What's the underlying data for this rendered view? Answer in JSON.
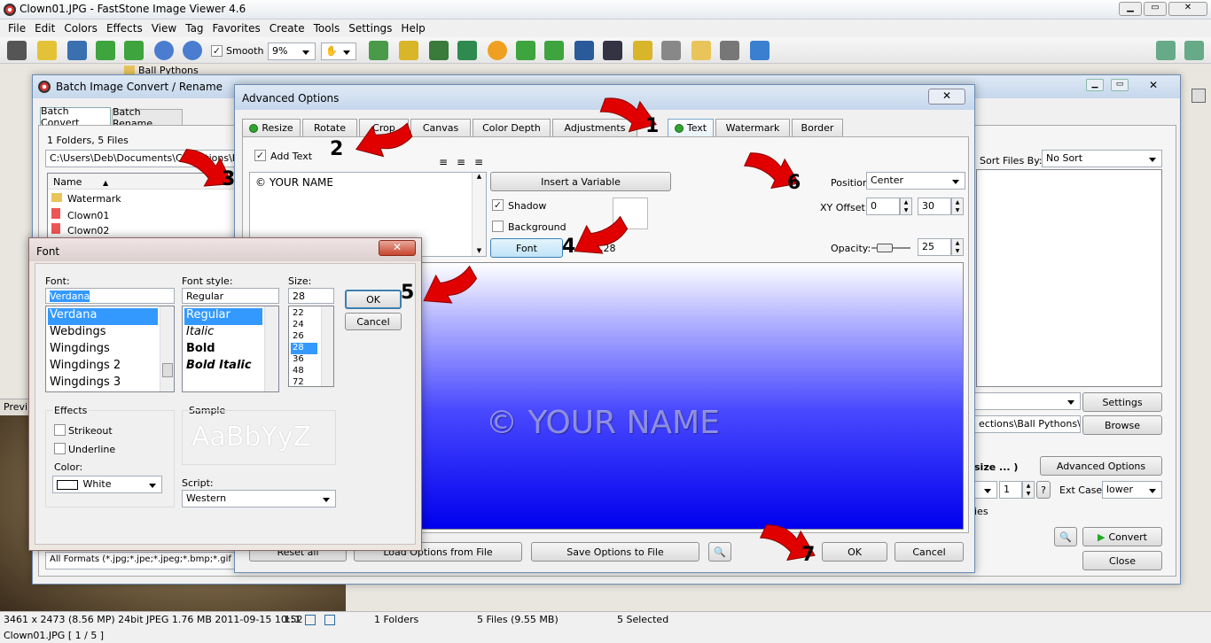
{
  "app": {
    "title": "Clown01.JPG  -  FastStone Image Viewer 4.6",
    "menu": [
      "File",
      "Edit",
      "Colors",
      "Effects",
      "View",
      "Tag",
      "Favorites",
      "Create",
      "Tools",
      "Settings",
      "Help"
    ],
    "smooth_label": "Smooth",
    "zoom": "9%",
    "tree_item": "Ball Pythons",
    "status": {
      "left": "3461 x 2473 (8.56 MP)  24bit  JPEG   1.76 MB   2011-09-15 10:52",
      "ratio": "1:1",
      "folders": "1 Folders",
      "files": "5 Files (9.55 MB)",
      "selected": "5 Selected",
      "bottom": "Clown01.JPG [ 1 / 5 ]"
    },
    "preview_label": "Previ"
  },
  "batch": {
    "title": "Batch Image Convert / Rename",
    "tabs": [
      "Batch Convert",
      "Batch Rename"
    ],
    "folder_info": "1 Folders, 5 Files",
    "path": "C:\\Users\\Deb\\Documents\\Collections\\Ball Pyt",
    "name_header": "Name",
    "files": [
      "Watermark",
      "Clown01",
      "Clown02"
    ],
    "sort_label": "Sort Files By:",
    "sort_value": "No Sort",
    "settings_btn": "Settings",
    "browse_btn": "Browse",
    "output_path": "ections\\Ball Pythons\\Clov",
    "resize_text": "size ... )",
    "advanced_btn": "Advanced Options",
    "spin_value": "1",
    "q_btn": "?",
    "ext_case_label": "Ext Case:",
    "ext_case_value": "lower",
    "ies_text": "ies",
    "convert_btn": "Convert",
    "close_btn": "Close",
    "formats": "All Formats (*.jpg;*.jpe;*.jpeg;*.bmp;*.gif"
  },
  "advanced": {
    "title": "Advanced Options",
    "tabs": [
      {
        "label": "Resize",
        "dot": true
      },
      {
        "label": "Rotate",
        "dot": false
      },
      {
        "label": "Crop",
        "dot": false
      },
      {
        "label": "Canvas",
        "dot": false
      },
      {
        "label": "Color Depth",
        "dot": false
      },
      {
        "label": "Adjustments",
        "dot": false
      },
      {
        "label": "Text",
        "dot": true
      },
      {
        "label": "Watermark",
        "dot": false
      },
      {
        "label": "Border",
        "dot": false
      }
    ],
    "add_text_label": "Add Text",
    "text_value": "© YOUR NAME",
    "insert_variable_btn": "Insert a Variable",
    "shadow_label": "Shadow",
    "background_label": "Background",
    "font_btn": "Font",
    "font_info": ",28",
    "position_label": "Position:",
    "position_value": "Center",
    "xy_offset_label": "XY Offset:",
    "x_offset": "0",
    "y_offset": "30",
    "opacity_label": "Opacity:",
    "opacity_value": "25",
    "preview_text": "© YOUR NAME",
    "reset_btn": "Reset all",
    "load_btn": "Load Options from File",
    "save_btn": "Save Options to File",
    "ok_btn": "OK",
    "cancel_btn": "Cancel"
  },
  "font_dialog": {
    "title": "Font",
    "font_label": "Font:",
    "font_value": "Verdana",
    "fonts": [
      "Verdana",
      "Webdings",
      "Wingdings",
      "Wingdings 2",
      "Wingdings 3"
    ],
    "style_label": "Font style:",
    "style_value": "Regular",
    "styles": [
      "Regular",
      "Italic",
      "Bold",
      "Bold Italic"
    ],
    "size_label": "Size:",
    "size_value": "28",
    "sizes": [
      "22",
      "24",
      "26",
      "28",
      "36",
      "48",
      "72"
    ],
    "ok_btn": "OK",
    "cancel_btn": "Cancel",
    "effects_label": "Effects",
    "strikeout_label": "Strikeout",
    "underline_label": "Underline",
    "color_label": "Color:",
    "color_value": "White",
    "sample_label": "Sample",
    "sample_text": "AaBbYyZ",
    "script_label": "Script:",
    "script_value": "Western"
  },
  "step_numbers": [
    "1",
    "2",
    "3",
    "4",
    "5",
    "6",
    "7"
  ],
  "colors": {
    "accent_blue": "#3399ff",
    "preview_top": "#ffffff",
    "preview_bottom": "#0000ee",
    "arrow_red": "#e00000",
    "green_dot": "#2ea52e"
  }
}
